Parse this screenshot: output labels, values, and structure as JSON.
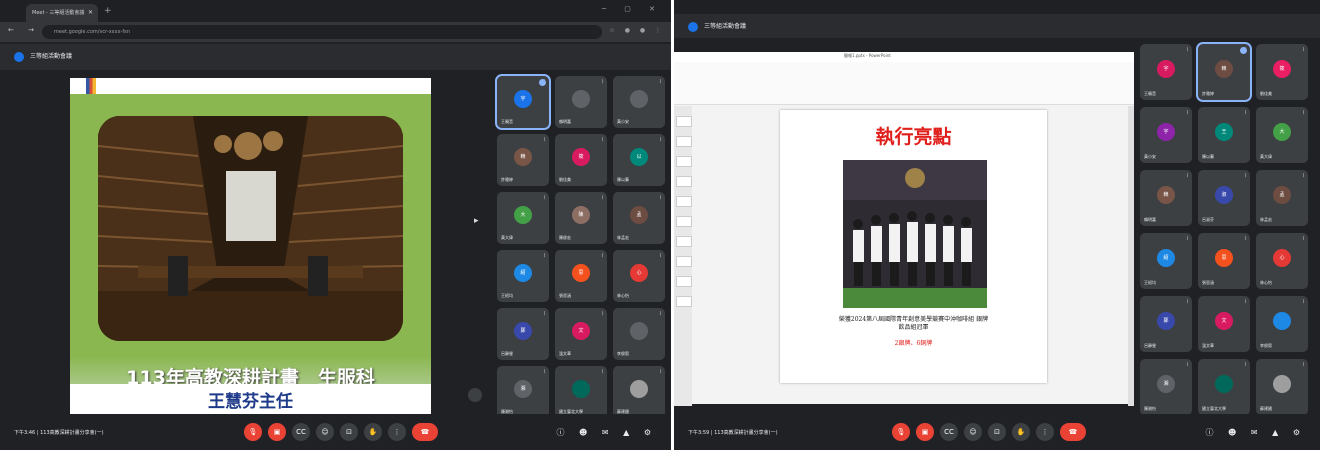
{
  "left": {
    "tab_label": "Meet - 三等組活動會議",
    "url": "meet.google.com/vcr-xxxx-fsn",
    "meeting_title": "三等組活動會議",
    "slide": {
      "title": "113年高教深耕計畫　生服科",
      "name": "王慧芬主任"
    },
    "tiles": [
      {
        "initials": "宇",
        "label": "王曉音",
        "color": "#1a73e8"
      },
      {
        "initials": "",
        "label": "賴明嘉",
        "color": "#5f6368"
      },
      {
        "initials": "",
        "label": "黃小安",
        "color": "#5f6368"
      },
      {
        "initials": "賴",
        "label": "許雅婷",
        "color": "#795548"
      },
      {
        "initials": "筱",
        "label": "劉佳美",
        "color": "#d81b60"
      },
      {
        "initials": "以",
        "label": "陳以蓁",
        "color": "#00897b"
      },
      {
        "initials": "大",
        "label": "黃大偉",
        "color": "#43a047"
      },
      {
        "initials": "陳",
        "label": "陳俊宏",
        "color": "#8d6e63"
      },
      {
        "initials": "孟",
        "label": "林孟宏",
        "color": "#6d4c41"
      },
      {
        "initials": "紹",
        "label": "王紹均",
        "color": "#1e88e5"
      },
      {
        "initials": "思",
        "label": "張思涵",
        "color": "#f4511e"
      },
      {
        "initials": "心",
        "label": "林心怡",
        "color": "#e53935"
      },
      {
        "initials": "鄭",
        "label": "呂靜瑩",
        "color": "#3949ab"
      },
      {
        "initials": "文",
        "label": "溫文華",
        "color": "#d81b60"
      },
      {
        "initials": "",
        "label": "李俊毅",
        "color": "#5f6368"
      },
      {
        "initials": "湘",
        "label": "陳湘怡",
        "color": "#5f6368"
      },
      {
        "initials": "",
        "label": "國立臺北大學",
        "color": "#00695c"
      },
      {
        "initials": "",
        "label": "蘇建國",
        "color": "#9e9e9e"
      }
    ],
    "clock": "下午3:46",
    "meeting_name": "113高教深耕計畫分享會(一)"
  },
  "right": {
    "meeting_title": "三等組活動會議",
    "ppt_title": "簡報1.pptx - PowerPoint",
    "slide_heading": "執行亮點",
    "slide_caption": "榮獲2024第八屆國際青年創意美學競賽中沖咖啡組 銀牌",
    "slide_caption2": "飲品組冠軍",
    "slide_award": "2銀牌、6銅牌",
    "tiles": [
      {
        "initials": "宇",
        "label": "王曉音",
        "color": "#d81b60"
      },
      {
        "initials": "賴",
        "label": "許雅婷",
        "color": "#6d4c41"
      },
      {
        "initials": "筱",
        "label": "劉佳美",
        "color": "#e91e63"
      },
      {
        "initials": "宇",
        "label": "黃小安",
        "color": "#8e24aa"
      },
      {
        "initials": "王",
        "label": "陳以蓁",
        "color": "#00897b"
      },
      {
        "initials": "大",
        "label": "黃大偉",
        "color": "#43a047"
      },
      {
        "initials": "賴",
        "label": "賴明嘉",
        "color": "#795548"
      },
      {
        "initials": "淑",
        "label": "呂淑芬",
        "color": "#3949ab"
      },
      {
        "initials": "孟",
        "label": "林孟宏",
        "color": "#6d4c41"
      },
      {
        "initials": "紹",
        "label": "王紹均",
        "color": "#1e88e5"
      },
      {
        "initials": "思",
        "label": "張思涵",
        "color": "#f4511e"
      },
      {
        "initials": "心",
        "label": "林心怡",
        "color": "#e53935"
      },
      {
        "initials": "鄭",
        "label": "呂靜瑩",
        "color": "#3949ab"
      },
      {
        "initials": "文",
        "label": "溫文華",
        "color": "#d81b60"
      },
      {
        "initials": "",
        "label": "李俊毅",
        "color": "#1e88e5"
      },
      {
        "initials": "湘",
        "label": "陳湘怡",
        "color": "#5f6368"
      },
      {
        "initials": "",
        "label": "國立臺北大學",
        "color": "#00695c"
      },
      {
        "initials": "",
        "label": "蘇建國",
        "color": "#9e9e9e"
      }
    ],
    "clock": "下午3:59",
    "meeting_name": "113高教深耕計畫分享會(一)"
  }
}
